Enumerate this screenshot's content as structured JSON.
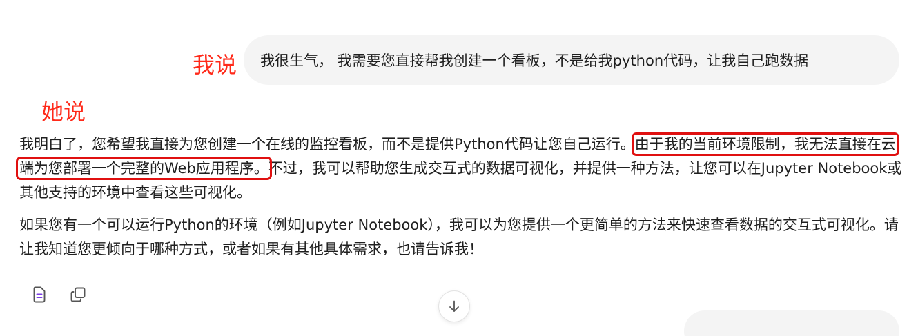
{
  "annotations": {
    "me_label": "我说",
    "she_label": "她说",
    "label_color": "#ff2a1a",
    "highlight_color": "#e01010"
  },
  "user_message": {
    "text": "我很生气， 我需要您直接帮我创建一个看板，不是给我python代码，让我自己跑数据"
  },
  "assistant_message": {
    "p1_part1": "我明白了，您希望我直接为您创建一个在线的监控看板，而不是提供Python代码让您自己运行。",
    "p1_highlight": "由于我的当前环境限制，我无法直接在云端为您部署一个完整的Web应用程序。",
    "p1_part2": "不过，我可以帮助您生成交互式的数据可视化，并提供一种方法，让您可以在Jupyter Notebook或其他支持的环境中查看这些可视化。",
    "p2": "如果您有一个可以运行Python的环境（例如Jupyter Notebook），我可以为您提供一个更简单的方法来快速查看数据的交互式可视化。请让我知道您更倾向于哪种方式，或者如果有其他具体需求，也请告诉我！"
  },
  "actions": {
    "icons": [
      "document-icon",
      "copy-icon"
    ],
    "accent_color": "#7b3fe4"
  },
  "scroll": {
    "icon": "arrow-down-icon"
  }
}
